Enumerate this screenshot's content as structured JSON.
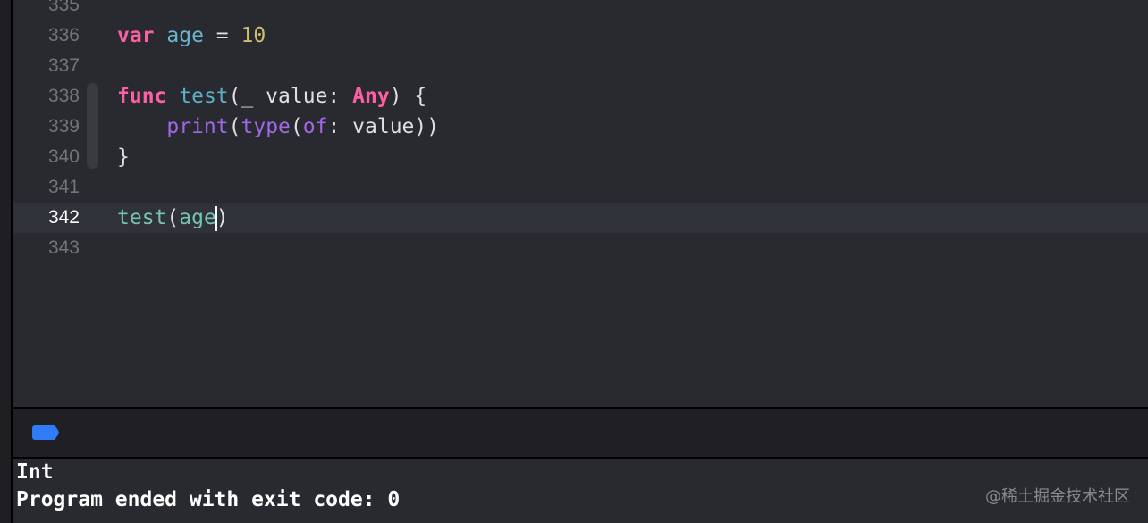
{
  "editor": {
    "lines": [
      {
        "number": "335",
        "tokens": []
      },
      {
        "number": "336",
        "tokens": [
          {
            "t": "var",
            "c": "kw"
          },
          {
            "t": " "
          },
          {
            "t": "age",
            "c": "var"
          },
          {
            "t": " = "
          },
          {
            "t": "10",
            "c": "num"
          }
        ]
      },
      {
        "number": "337",
        "tokens": []
      },
      {
        "number": "338",
        "tokens": [
          {
            "t": "func",
            "c": "kw"
          },
          {
            "t": " "
          },
          {
            "t": "test",
            "c": "decl"
          },
          {
            "t": "(_ value: "
          },
          {
            "t": "Any",
            "c": "kw"
          },
          {
            "t": ") {"
          }
        ]
      },
      {
        "number": "339",
        "tokens": [
          {
            "t": "    "
          },
          {
            "t": "print",
            "c": "sys"
          },
          {
            "t": "("
          },
          {
            "t": "type",
            "c": "sys"
          },
          {
            "t": "("
          },
          {
            "t": "of",
            "c": "sys"
          },
          {
            "t": ": value))"
          }
        ]
      },
      {
        "number": "340",
        "tokens": [
          {
            "t": "}"
          }
        ]
      },
      {
        "number": "341",
        "tokens": []
      },
      {
        "number": "342",
        "current": true,
        "tokens": [
          {
            "t": "test",
            "c": "proj"
          },
          {
            "t": "("
          },
          {
            "t": "age",
            "c": "proj"
          },
          {
            "caret": true
          },
          {
            "t": ")"
          }
        ]
      },
      {
        "number": "343",
        "tokens": []
      }
    ]
  },
  "debug": {
    "breakpoint_icon": "breakpoint-toggle-icon",
    "breakpoint_color": "#2f7cf6"
  },
  "console": {
    "output": [
      "Int",
      "Program ended with exit code: 0"
    ]
  },
  "watermark": "@稀土掘金技术社区"
}
